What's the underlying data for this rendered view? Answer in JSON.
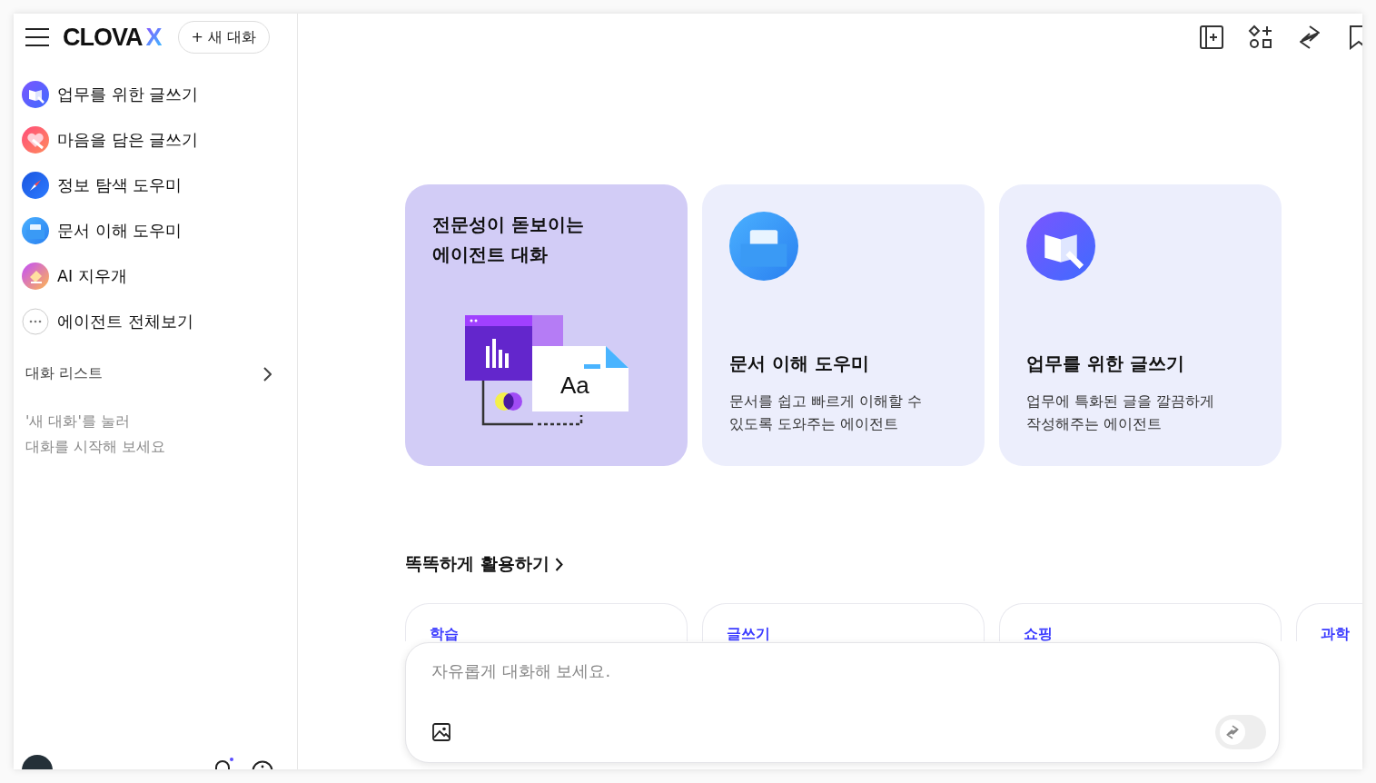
{
  "sidebar": {
    "logo": {
      "name": "CLOVA",
      "mark": "X"
    },
    "new_chat_button": {
      "icon": "+",
      "label": "새 대화"
    },
    "agents": [
      {
        "label": "업무를 위한 글쓰기",
        "kind": "book"
      },
      {
        "label": "마음을 담은 글쓰기",
        "kind": "heart"
      },
      {
        "label": "정보 탐색 도우미",
        "kind": "compass"
      },
      {
        "label": "문서 이해 도우미",
        "kind": "folder"
      },
      {
        "label": "AI 지우개",
        "kind": "eraser"
      },
      {
        "label": "에이전트 전체보기",
        "kind": "more"
      }
    ],
    "chat_list": {
      "title": "대화 리스트",
      "hint": "'새 대화'를 눌러\n대화를 시작해 보세요"
    }
  },
  "cards": [
    {
      "kind": "promo",
      "title": "전문성이 돋보이는\n에이전트 대화",
      "art_text": "Aa"
    },
    {
      "kind": "folder",
      "title": "문서 이해 도우미",
      "description": "문서를 쉽고 빠르게 이해할 수\n있도록 도와주는 에이전트"
    },
    {
      "kind": "book",
      "title": "업무를 위한 글쓰기",
      "description": "업무에 특화된 글을 깔끔하게\n작성해주는 에이전트"
    }
  ],
  "section": {
    "title": "똑똑하게 활용하기",
    "chips": [
      "학습",
      "글쓰기",
      "쇼핑",
      "과학"
    ]
  },
  "composer": {
    "placeholder": "자유롭게 대화해 보세요.",
    "agent_toggle": {
      "on": false
    }
  }
}
